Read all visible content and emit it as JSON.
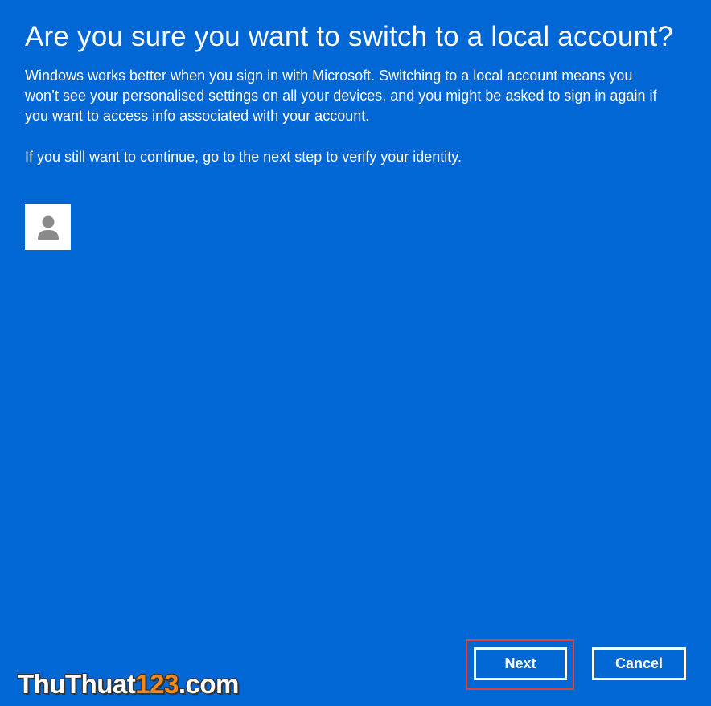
{
  "dialog": {
    "title": "Are you sure you want to switch to a local account?",
    "description": "Windows works better when you sign in with Microsoft. Switching to a local account means you won’t see your personalised settings on all your devices, and you might be asked to sign in again if you want to access info associated with your account.",
    "continue_text": "If you still want to continue, go to the next step to verify your identity."
  },
  "account": {
    "avatar_icon": "person-icon",
    "name_blurred": "",
    "email_blurred": ""
  },
  "buttons": {
    "next_label": "Next",
    "cancel_label": "Cancel"
  },
  "watermark": {
    "text_main": "ThuThuat",
    "text_num": "123",
    "text_tld": ".com"
  },
  "colors": {
    "background": "#0067d4",
    "text": "#ffffff",
    "highlight": "#e04040",
    "watermark_accent": "#f08a20"
  }
}
